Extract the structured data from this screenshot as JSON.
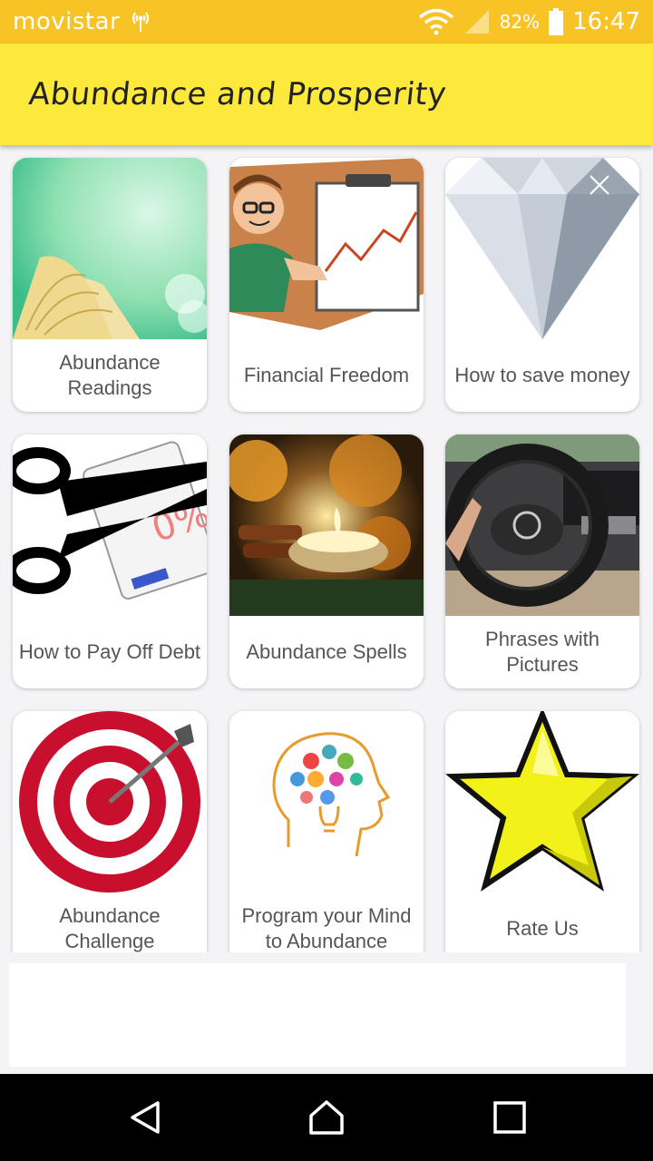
{
  "status_bar": {
    "carrier": "movistar",
    "battery_percent": "82%",
    "time": "16:47",
    "icons": [
      "hotspot-icon",
      "wifi-icon",
      "signal-icon",
      "battery-icon"
    ]
  },
  "app_bar": {
    "title": "Abundance and Prosperity"
  },
  "menu": {
    "items": [
      {
        "label": "Abundance Readings",
        "icon": "book-icon"
      },
      {
        "label": "Financial Freedom",
        "icon": "chart-board-icon"
      },
      {
        "label": "How to save money",
        "icon": "diamond-icon"
      },
      {
        "label": "How to Pay Off Debt",
        "icon": "scissors-card-icon"
      },
      {
        "label": "Abundance Spells",
        "icon": "candle-icon"
      },
      {
        "label": "Phrases with Pictures",
        "icon": "steering-wheel-icon"
      },
      {
        "label": "Abundance Challenge",
        "icon": "target-icon"
      },
      {
        "label": "Program your Mind to Abundance",
        "icon": "brain-bulb-icon"
      },
      {
        "label": "Rate Us",
        "icon": "star-icon"
      }
    ]
  },
  "colors": {
    "status_bar": "#f7c325",
    "app_bar": "#fde93c",
    "label_text": "#555555",
    "nav_bar": "#000000"
  },
  "nav_bar": {
    "buttons": [
      "back-icon",
      "home-icon",
      "recents-icon"
    ]
  }
}
